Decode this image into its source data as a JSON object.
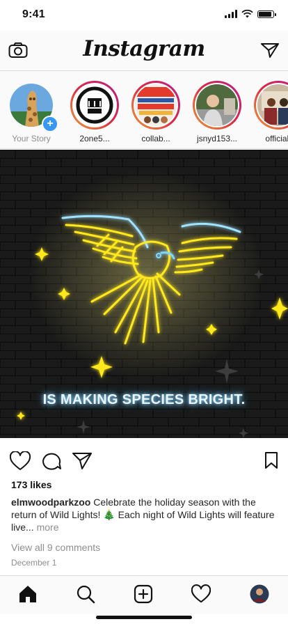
{
  "status_bar": {
    "time": "9:41",
    "battery_level": 0.9,
    "signal_bars": 4
  },
  "header": {
    "app_title": "Instagram"
  },
  "stories": [
    {
      "name": "Your Story",
      "own": true,
      "avatar": "giraffe-avatar"
    },
    {
      "name": "2one5...",
      "avatar": "logo-avatar"
    },
    {
      "name": "collab...",
      "avatar": "poster-avatar"
    },
    {
      "name": "jsnyd153...",
      "avatar": "man-avatar"
    },
    {
      "name": "officialt",
      "avatar": "group-avatar"
    }
  ],
  "post": {
    "image_text": "IS MAKING SPECIES BRIGHT.",
    "likes": "173 likes",
    "username": "elmwoodparkzoo",
    "caption": "Celebrate the holiday season with the return of Wild Lights! 🎄 Each night of Wild Lights will feature live...",
    "more_label": "more",
    "view_comments": "View all 9 comments",
    "date": "December 1"
  },
  "colors": {
    "story_ring": "#dc2743",
    "accent_blue": "#3897f0",
    "neon_yellow": "#ffe81a",
    "neon_blue": "#7fd6ff"
  },
  "tabs": [
    "home-icon",
    "search-icon",
    "new-post-icon",
    "activity-heart-icon",
    "profile-avatar"
  ]
}
